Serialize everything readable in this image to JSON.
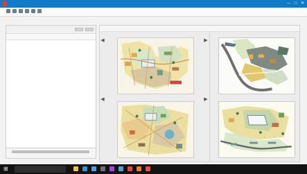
{
  "window": {
    "title": "",
    "controls": {
      "minimize": "─",
      "maximize": "□",
      "close": "✕"
    },
    "accent": "#0f7ac6",
    "app_icon_color": "#e23b2e"
  },
  "toolbar": {
    "icons": [
      "toolbar-icon-1",
      "toolbar-icon-2",
      "toolbar-icon-3",
      "toolbar-icon-4",
      "toolbar-icon-5",
      "toolbar-icon-6"
    ]
  },
  "left_panel": {
    "header_label": "",
    "columns": [
      "",
      "",
      ""
    ],
    "status": ""
  },
  "main": {
    "tab_label": "",
    "nav": {
      "left": "◀",
      "right": "▶"
    },
    "tiles": [
      {
        "name": "map-page-1",
        "description": ""
      },
      {
        "name": "map-page-2",
        "description": ""
      },
      {
        "name": "map-page-3",
        "description": ""
      },
      {
        "name": "map-page-4",
        "description": ""
      }
    ]
  },
  "taskbar": {
    "search_placeholder": "",
    "tray_text": "",
    "taskbar_icons": [
      "file-explorer-icon",
      "browser-icon",
      "mail-icon",
      "store-icon",
      "app-icon",
      "app-icon",
      "app-icon",
      "app-icon",
      "app-icon"
    ]
  }
}
